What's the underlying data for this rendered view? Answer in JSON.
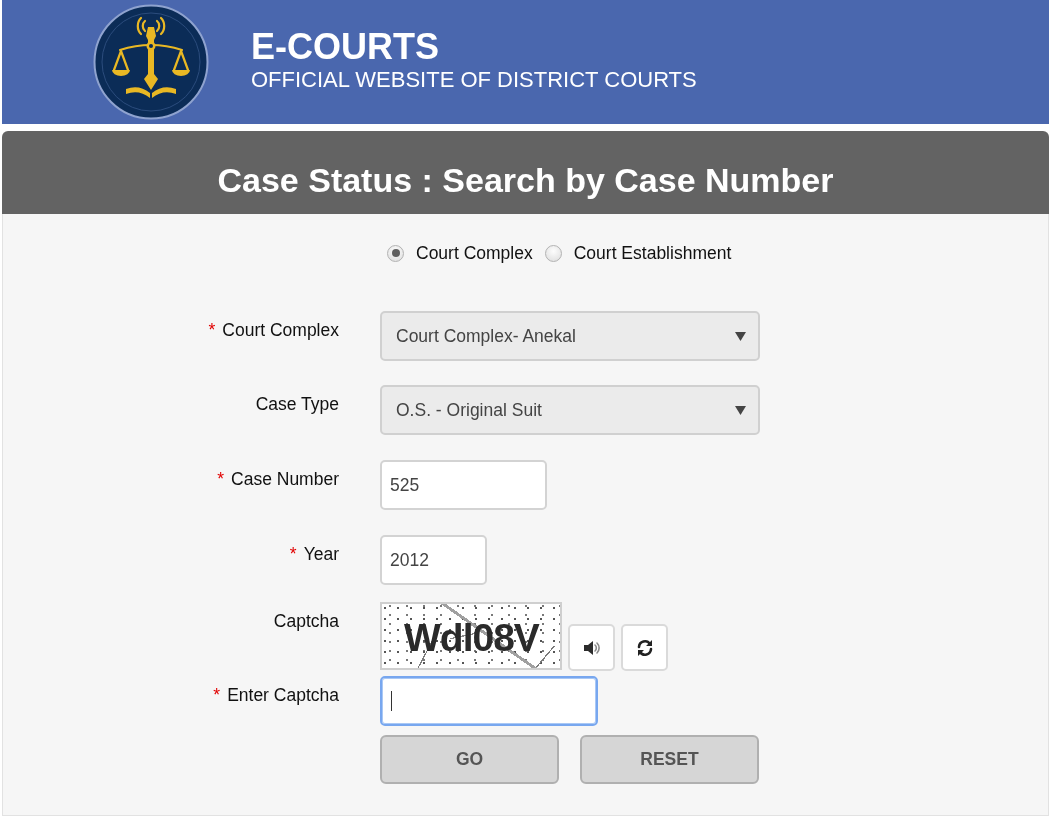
{
  "header": {
    "title": "E-COURTS",
    "subtitle": "OFFICIAL WEBSITE OF DISTRICT COURTS"
  },
  "page_title": "Case Status : Search by Case Number",
  "search_mode": [
    {
      "label": "Court Complex",
      "selected": true
    },
    {
      "label": "Court Establishment",
      "selected": false
    }
  ],
  "fields": [
    {
      "kind": "select",
      "required_mark": "*",
      "label": "Court Complex",
      "value": "Court Complex- Anekal",
      "focused": false
    },
    {
      "kind": "select",
      "label": "Case Type",
      "value": "O.S. - Original Suit",
      "focused": false
    },
    {
      "kind": "text",
      "required_mark": "*",
      "label": "Case Number",
      "value": "525",
      "focused": false
    },
    {
      "kind": "text",
      "required_mark": "*",
      "label": "Year",
      "value": "2012",
      "focused": false
    },
    {
      "kind": "captcha",
      "label": "Captcha",
      "captcha_text": "Wdl08V",
      "focused": false
    },
    {
      "kind": "text",
      "required_mark": "*",
      "label": "Enter Captcha",
      "focused": true
    }
  ],
  "buttons": [
    "GO",
    "RESET"
  ]
}
